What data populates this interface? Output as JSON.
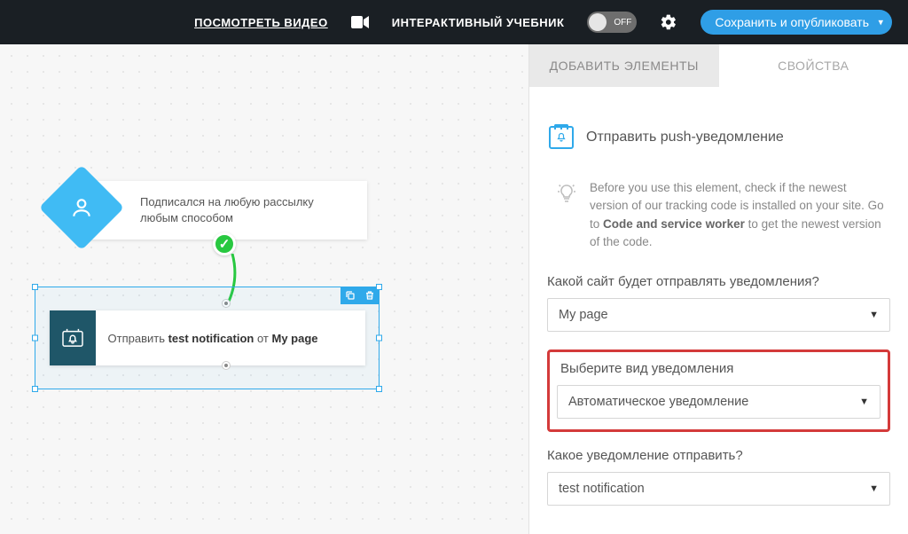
{
  "header": {
    "video_link": "ПОСМОТРЕТЬ ВИДЕО",
    "tutorial_label": "ИНТЕРАКТИВНЫЙ УЧЕБНИК",
    "toggle_state": "OFF",
    "publish_button": "Сохранить и опубликовать"
  },
  "canvas": {
    "trigger_text": "Подписался на любую рассылку любым способом",
    "action_prefix": "Отправить ",
    "action_notif": "test notification",
    "action_mid": " от ",
    "action_page": "My page"
  },
  "sidebar": {
    "tab_add": "ДОБАВИТЬ ЭЛЕМЕНТЫ",
    "tab_props": "СВОЙСТВА",
    "panel_title": "Отправить push-уведомление",
    "hint_p1": "Before you use this element, check if the newest version of our tracking code is installed on your site. Go to ",
    "hint_b": "Code and service worker",
    "hint_p2": " to get the newest version of the code.",
    "site_label": "Какой сайт будет отправлять уведомления?",
    "site_value": "My page",
    "type_label": "Выберите вид уведомления",
    "type_value": "Автоматическое уведомление",
    "notif_label": "Какое уведомление отправить?",
    "notif_value": "test notification"
  }
}
